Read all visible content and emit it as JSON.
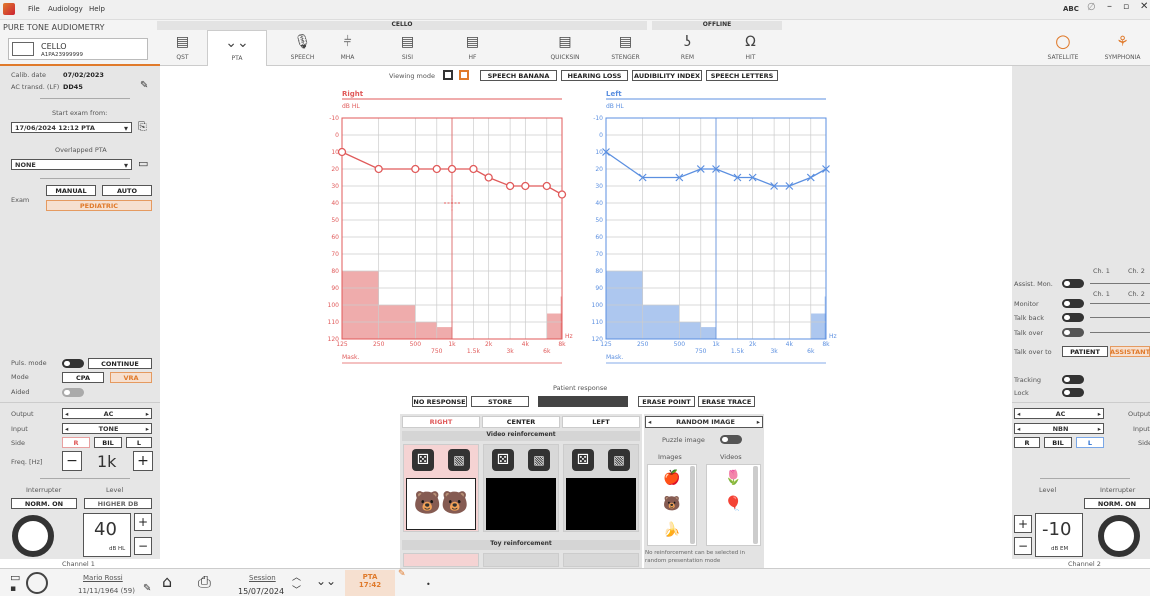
{
  "titlebar": {
    "menu_file": "File",
    "menu_audiology": "Audiology",
    "menu_help": "Help",
    "right_abc": "ABC"
  },
  "header": {
    "title": "PURE TONE AUDIOMETRY",
    "device": "CELLO",
    "serial": "A1PA23999999",
    "group_cello": "CELLO",
    "group_offline": "OFFLINE"
  },
  "tools": [
    {
      "label": "QST"
    },
    {
      "label": "PTA"
    },
    {
      "label": "SPEECH"
    },
    {
      "label": "MHA"
    },
    {
      "label": "SISI"
    },
    {
      "label": "HF"
    },
    {
      "label": "QUICKSIN"
    },
    {
      "label": "STENGER"
    },
    {
      "label": "REM"
    },
    {
      "label": "HIT"
    }
  ],
  "right_tools": {
    "satellite": "SATELLITE",
    "symphonia": "SYMPHONIA"
  },
  "left": {
    "calib_label": "Calib. date",
    "calib_value": "07/02/2023",
    "transd_label": "AC transd. (LF)",
    "transd_value": "DD45",
    "start_exam": "Start exam from:",
    "start_value": "17/06/2024 12:12 PTA",
    "overlapped": "Overlapped PTA",
    "overlapped_value": "NONE",
    "exam_label": "Exam",
    "manual": "MANUAL",
    "auto": "AUTO",
    "pediatric": "PEDIATRIC",
    "puls_mode": "Puls. mode",
    "continue": "CONTINUE",
    "mode": "Mode",
    "cpa": "CPA",
    "vra": "VRA",
    "aided": "Aided",
    "output": "Output",
    "output_val": "AC",
    "input": "Input",
    "input_val": "TONE",
    "side": "Side",
    "side_r": "R",
    "side_bil": "BIL",
    "side_l": "L",
    "freq": "Freq. [Hz]",
    "freq_val": "1k",
    "interrupter": "Interrupter",
    "level": "Level",
    "norm_on": "NORM. ON",
    "higher_db": "HIGHER DB",
    "level_val": "40",
    "level_unit": "dB HL",
    "channel": "Channel 1"
  },
  "right": {
    "ch1": "Ch. 1",
    "ch2": "Ch. 2",
    "assist_mon": "Assist. Mon.",
    "monitor": "Monitor",
    "talk_back": "Talk back",
    "talk_over": "Talk over",
    "talk_over_to": "Talk over to",
    "patient": "PATIENT",
    "assistant": "ASSISTANT",
    "tracking": "Tracking",
    "lock": "Lock",
    "output_val": "AC",
    "output": "Output",
    "input_val": "NBN",
    "input": "Input",
    "side_r": "R",
    "side_bil": "BIL",
    "side_l": "L",
    "side": "Side",
    "level": "Level",
    "interrupter": "Interrupter",
    "norm_on": "NORM. ON",
    "level_val": "-10",
    "level_unit": "dB EM",
    "channel": "Channel 2"
  },
  "viewing": {
    "label": "Viewing mode",
    "speech_banana": "SPEECH BANANA",
    "hearing_loss": "HEARING LOSS",
    "audibility_index": "AUDIBILITY INDEX",
    "speech_letters": "SPEECH LETTERS"
  },
  "chart_data": [
    {
      "type": "line",
      "title": "Right",
      "ylabel": "dB HL",
      "ylim": [
        -10,
        120
      ],
      "yticks": [
        -10,
        0,
        10,
        20,
        30,
        40,
        50,
        60,
        70,
        80,
        90,
        100,
        110,
        120
      ],
      "x": [
        125,
        250,
        500,
        750,
        1000,
        1500,
        2000,
        3000,
        4000,
        6000,
        8000
      ],
      "xticks_top": [
        "125",
        "250",
        "500",
        "1k",
        "2k",
        "4k",
        "8k"
      ],
      "xticks_bottom": [
        "750",
        "1.5k",
        "3k",
        "6k"
      ],
      "xunit": "Hz",
      "mask": "Mask.",
      "series": [
        {
          "values": [
            10,
            20,
            20,
            20,
            20,
            20,
            25,
            30,
            30,
            30,
            35
          ],
          "color": "#e05a5a",
          "marker": "circle"
        }
      ],
      "color": "#e05a5a"
    },
    {
      "type": "line",
      "title": "Left",
      "ylabel": "dB HL",
      "ylim": [
        -10,
        120
      ],
      "yticks": [
        -10,
        0,
        10,
        20,
        30,
        40,
        50,
        60,
        70,
        80,
        90,
        100,
        110,
        120
      ],
      "x": [
        125,
        250,
        500,
        750,
        1000,
        1500,
        2000,
        3000,
        4000,
        6000,
        8000
      ],
      "xticks_top": [
        "125",
        "250",
        "500",
        "1k",
        "2k",
        "4k",
        "8k"
      ],
      "xticks_bottom": [
        "750",
        "1.5k",
        "3k",
        "6k"
      ],
      "xunit": "Hz",
      "mask": "Mask.",
      "series": [
        {
          "values": [
            10,
            25,
            25,
            20,
            20,
            25,
            25,
            30,
            30,
            25,
            20
          ],
          "color": "#5b8fe0",
          "marker": "x"
        }
      ],
      "color": "#5b8fe0"
    }
  ],
  "response": {
    "label": "Patient response",
    "no_response": "NO RESPONSE",
    "store": "STORE",
    "erase_point": "ERASE POINT",
    "erase_trace": "ERASE TRACE"
  },
  "reinforce": {
    "right": "RIGHT",
    "center": "CENTER",
    "left": "LEFT",
    "video": "Video reinforcement",
    "toy": "Toy reinforcement",
    "random_image": "RANDOM IMAGE",
    "puzzle": "Puzzle image",
    "images": "Images",
    "videos": "Videos",
    "note": "No reinforcement can be selected in random presentation mode"
  },
  "footer": {
    "patient_name": "Mario Rossi",
    "patient_dob": "11/11/1964 (59)",
    "session_label": "Session",
    "session_date": "15/07/2024",
    "pta_label": "PTA",
    "pta_time": "17:42"
  },
  "colors": {
    "right": "#e05a5a",
    "left": "#5b8fe0",
    "accent": "#e07a2b"
  }
}
